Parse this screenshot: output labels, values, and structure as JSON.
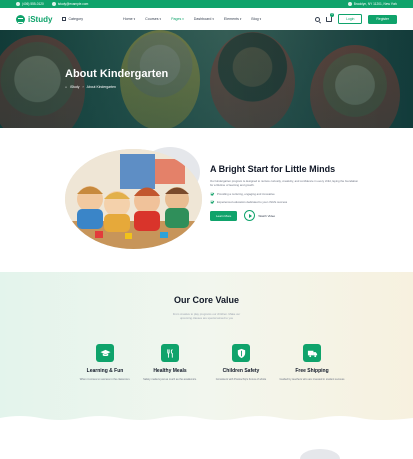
{
  "topbar": {
    "phone": "(406) 555-0120",
    "email": "istudy@example.com",
    "address": "Brooklyn, NY 11201, New York"
  },
  "header": {
    "logo_text": "iStudy",
    "category_label": "Category",
    "nav": [
      {
        "label": "Home"
      },
      {
        "label": "Courses"
      },
      {
        "label": "Pages"
      },
      {
        "label": "Dashboard"
      },
      {
        "label": "Elements"
      },
      {
        "label": "Blog"
      }
    ],
    "cart_count": "0",
    "login_label": "Login",
    "register_label": "Register"
  },
  "hero": {
    "title": "About Kindergarten",
    "breadcrumb_home": "iStudy",
    "breadcrumb_sep": "›",
    "breadcrumb_current": "About Kindergarten"
  },
  "intro": {
    "title": "A Bright Start for Little Minds",
    "text": "Our kindergarten program is designed to nurture curiosity, creativity, and confidence in every child, laying the foundation for a lifetime of learning and growth.",
    "bullets": [
      "Providing a nurturing, engaging and innovative",
      "Experienced educators dedicated to your child's success"
    ],
    "learn_more_label": "Learn More",
    "watch_label": "Watch Video"
  },
  "core": {
    "title": "Our Core Value",
    "subtitle_line1": "From creative to play programs our children. Make our",
    "subtitle_line2": "upcoming classes are special aimed to you",
    "values": [
      {
        "icon": "graduation-cap-icon",
        "title": "Learning & Fun",
        "desc": "When it comes to success in the classroom."
      },
      {
        "icon": "utensils-icon",
        "title": "Healthy Meals",
        "desc": "Safety matters just as much as the academics."
      },
      {
        "icon": "shield-icon",
        "title": "Children Safety",
        "desc": "Consistent with Pretoschip's Focus of whole"
      },
      {
        "icon": "truck-icon",
        "title": "Free Shipping",
        "desc": "Guided by teachers who are invested in student success"
      }
    ]
  },
  "colors": {
    "brand": "#0fa36b",
    "hero_overlay": "#2f5b52"
  }
}
